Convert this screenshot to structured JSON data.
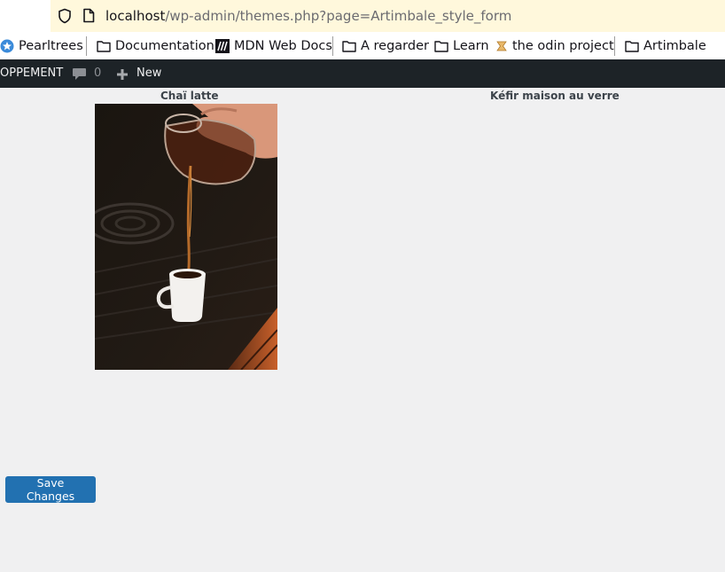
{
  "browser": {
    "url_host": "localhost",
    "url_path": "/wp-admin/themes.php?page=Artimbale_style_form",
    "bookmarks": [
      {
        "label": "Pearltrees",
        "icon": "pearltrees-icon"
      },
      {
        "label": "Documentation",
        "icon": "folder-icon"
      },
      {
        "label": "MDN Web Docs",
        "icon": "mdn-icon"
      },
      {
        "label": "A regarder",
        "icon": "folder-icon"
      },
      {
        "label": "Learn",
        "icon": "folder-icon"
      },
      {
        "label": "the odin project",
        "icon": "odin-icon"
      },
      {
        "label": "Artimbale",
        "icon": "folder-icon"
      }
    ]
  },
  "admin_bar": {
    "site_label": "OPPEMENT",
    "comments_count": "0",
    "new_label": "New"
  },
  "content": {
    "columns": [
      {
        "title": "Chaï latte"
      },
      {
        "title": "Kéfir maison au verre"
      }
    ],
    "save_label": "Save Changes"
  },
  "colors": {
    "admin_bar_bg": "#1d2327",
    "primary_button": "#2271b1",
    "page_bg": "#f0f0f1",
    "url_field_bg": "#fff8dc"
  }
}
